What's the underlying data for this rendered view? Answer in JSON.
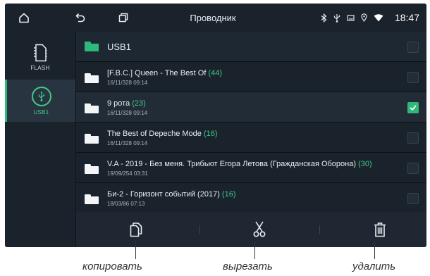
{
  "statusbar": {
    "home_icon": "home-icon",
    "back_icon": "back-icon",
    "recent_icon": "recent-apps-icon",
    "title": "Проводник",
    "status_icons": [
      "bluetooth-icon",
      "usb-icon",
      "image-icon",
      "location-icon",
      "wifi-icon"
    ],
    "time": "18:47"
  },
  "sidebar": {
    "drives": [
      {
        "label": "FLASH",
        "icon": "sd-card-icon",
        "selected": false
      },
      {
        "label": "USB1",
        "icon": "usb-icon",
        "selected": true
      }
    ]
  },
  "current_folder": {
    "name": "USB1",
    "checked": false
  },
  "files": [
    {
      "name": "[F.B.C.] Queen - The Best Of",
      "count": "(44)",
      "date": "16/11/328 09:14",
      "checked": false
    },
    {
      "name": "9 рота",
      "count": "(23)",
      "date": "16/11/328 09:14",
      "checked": true
    },
    {
      "name": "The Best of Depeche Mode",
      "count": "(16)",
      "date": "16/11/328 09:14",
      "checked": false
    },
    {
      "name": "V.A - 2019 - Без меня. Трибьют Егора Летова (Гражданская Оборона)",
      "count": "(30)",
      "date": "19/09/254 03:31",
      "checked": false
    },
    {
      "name": "Би-2 - Горизонт событий (2017)",
      "count": "(16)",
      "date": "18/03/86 07:13",
      "checked": false
    }
  ],
  "toolbar": {
    "copy_icon": "copy-icon",
    "cut_icon": "scissors-icon",
    "delete_icon": "trash-icon"
  },
  "callouts": {
    "copy": "копировать",
    "cut": "вырезать",
    "delete": "удалить"
  },
  "colors": {
    "accent": "#2fb87b",
    "background": "#111820",
    "panel": "#1a222b"
  }
}
